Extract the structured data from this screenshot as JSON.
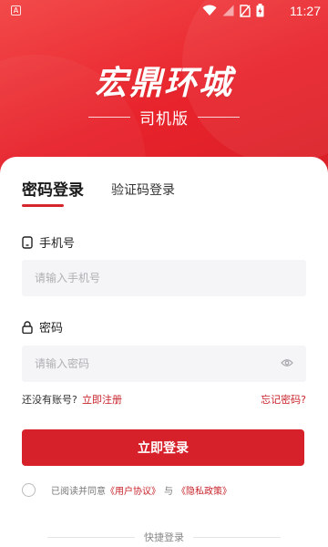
{
  "status_bar": {
    "badge": "A",
    "time": "11:27",
    "icons": [
      "wifi-icon",
      "signal-icon",
      "no-sim-icon",
      "battery-icon"
    ]
  },
  "brand": {
    "title": "宏鼎环城",
    "subtitle": "司机版"
  },
  "tabs": {
    "active": "密码登录",
    "inactive": "验证码登录"
  },
  "phone": {
    "label": "手机号",
    "placeholder": "请输入手机号",
    "value": ""
  },
  "password": {
    "label": "密码",
    "placeholder": "请输入密码",
    "value": ""
  },
  "links": {
    "no_account": "还没有账号?",
    "register": "立即注册",
    "forgot": "忘记密码?"
  },
  "login_button": "立即登录",
  "agreement": {
    "prefix": "已阅读并同意",
    "user_agreement": "《用户协议》",
    "and": "与",
    "privacy_policy": "《隐私政策》"
  },
  "quick_login": "快捷登录",
  "colors": {
    "brand_red": "#d6212a",
    "link_red": "#c8232b",
    "input_bg": "#f5f5f7"
  }
}
